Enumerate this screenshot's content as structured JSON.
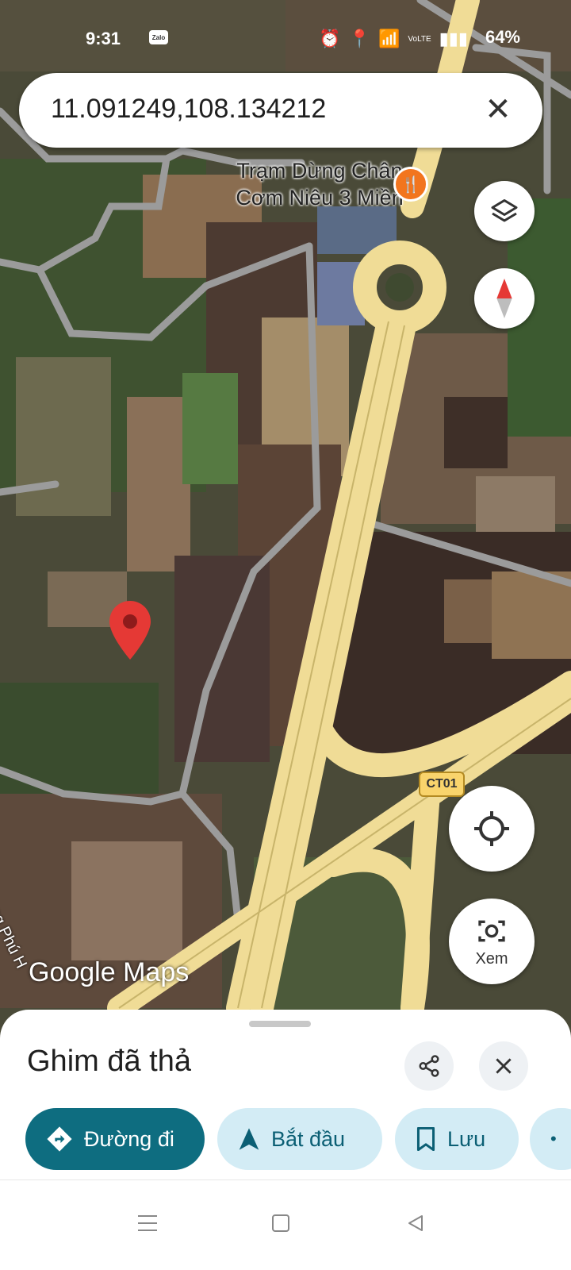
{
  "status_bar": {
    "time": "9:31",
    "zalo_label": "Zalo",
    "battery": "64%",
    "network": "VoLTE"
  },
  "search": {
    "query": "11.091249,108.134212",
    "clear_symbol": "✕"
  },
  "map": {
    "poi_name_line1": "Trạm Dừng Chân",
    "poi_name_line2": "Cơm Niêu 3 Miền",
    "poi_icon": "restaurant-icon",
    "river_label": "sông Phú H",
    "road_shield": "CT01",
    "wordmark": "Google Maps",
    "pin_color": "#e53935"
  },
  "controls": {
    "lens_label": "Xem"
  },
  "sheet": {
    "title": "Ghim đã thả",
    "chips": [
      {
        "label": "Đường đi",
        "icon": "directions-icon"
      },
      {
        "label": "Bắt đầu",
        "icon": "navigation-arrow-icon"
      },
      {
        "label": "Lưu",
        "icon": "bookmark-icon"
      },
      {
        "label": "",
        "icon": "more-icon"
      }
    ]
  },
  "colors": {
    "primary": "#0e6d80",
    "chip_bg": "#d3ecf5",
    "road": "#f0dc96"
  }
}
